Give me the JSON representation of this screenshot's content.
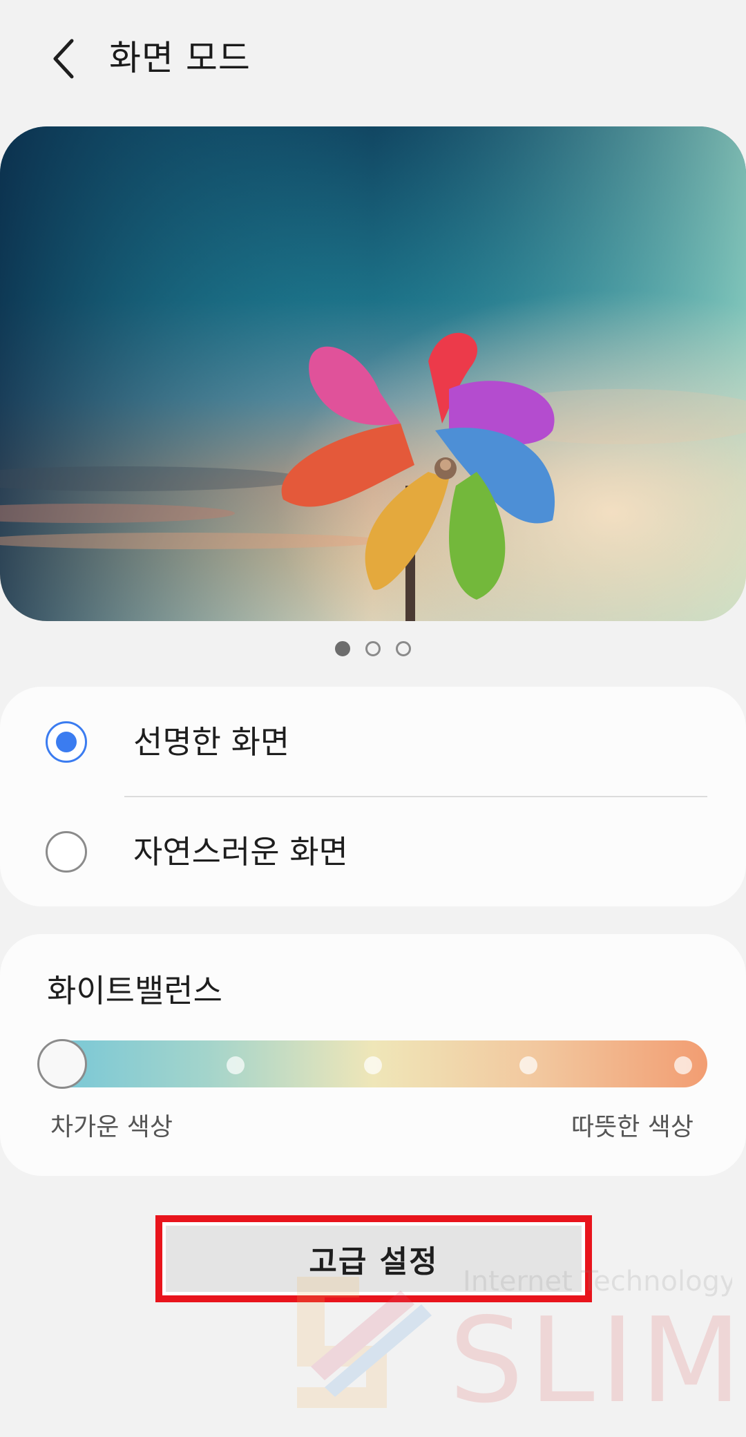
{
  "header": {
    "back_icon": "chevron-left-icon",
    "title": "화면 모드"
  },
  "preview": {
    "image": "pinwheel-sunset-image",
    "page_count": 3,
    "current_page": 1
  },
  "screen_mode": {
    "options": [
      {
        "label": "선명한 화면",
        "selected": true
      },
      {
        "label": "자연스러운 화면",
        "selected": false
      }
    ],
    "accent_color": "#3b7cf0"
  },
  "white_balance": {
    "title": "화이트밸런스",
    "cold_label": "차가운 색상",
    "warm_label": "따뜻한 색상",
    "steps": 5,
    "selected_step": 1,
    "colors": {
      "cold": "#74c6d8",
      "neutral": "#efe6b8",
      "warm": "#f29d72"
    }
  },
  "advanced": {
    "label": "고급 설정",
    "highlight_color": "#e8141c"
  },
  "watermark": {
    "small_text": "Internet Technology",
    "big_text": "SLIM"
  }
}
